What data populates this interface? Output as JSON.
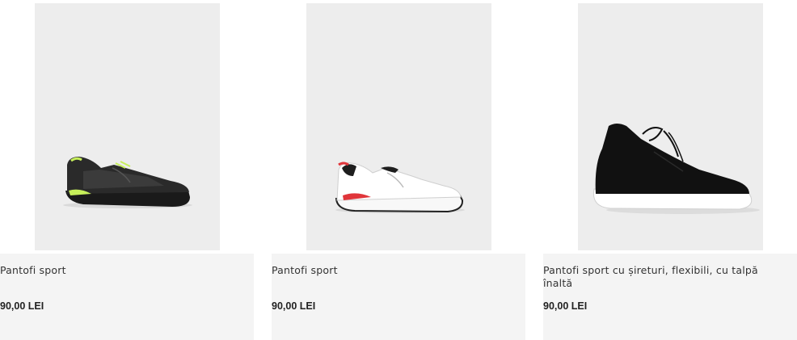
{
  "products": [
    {
      "title": "Pantofi sport",
      "price": "90,00 LEI",
      "image": "black-sneaker-lime-accents"
    },
    {
      "title": "Pantofi sport",
      "price": "90,00 LEI",
      "image": "white-sneaker-red-accents"
    },
    {
      "title": "Pantofi sport cu șireturi, flexibili, cu talpă înaltă",
      "price": "90,00 LEI",
      "image": "black-knit-high-top-sneaker"
    }
  ],
  "colors": {
    "image_bg": "#ededed",
    "info_bg": "#f4f4f4",
    "accent_lime": "#c6ef5a",
    "accent_red": "#e0353a"
  }
}
